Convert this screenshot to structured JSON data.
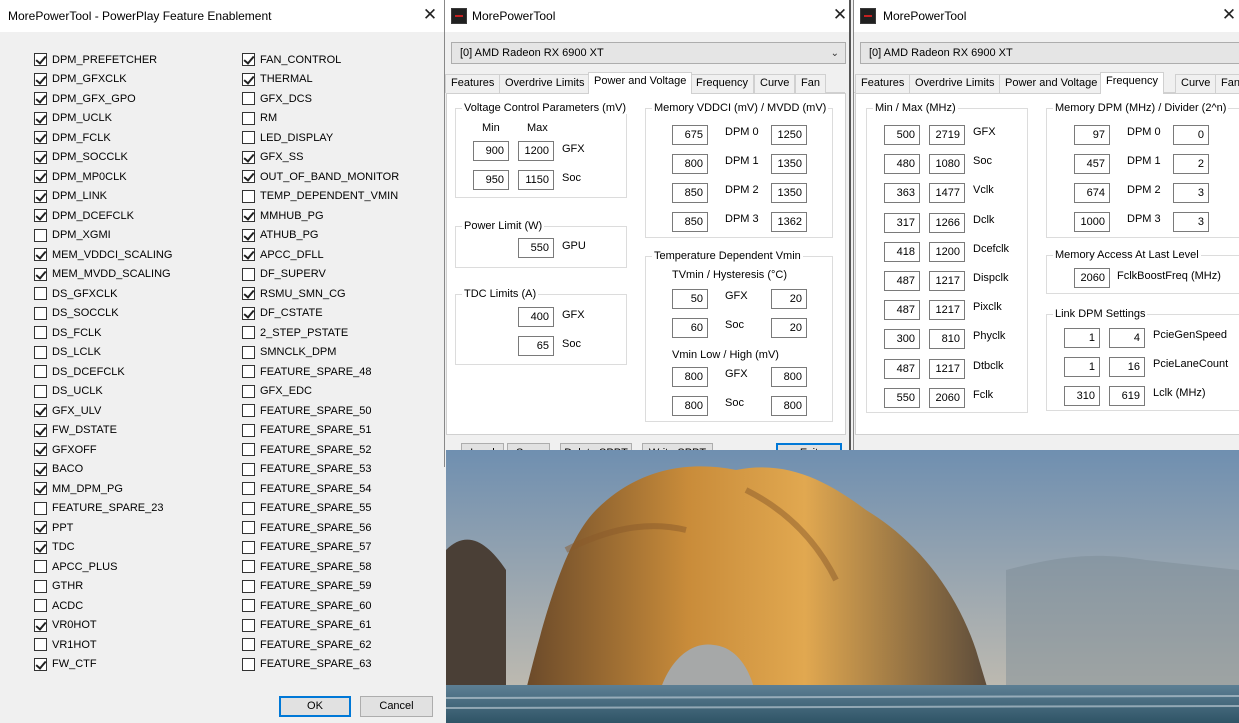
{
  "win1": {
    "title": "MorePowerTool - PowerPlay Feature Enablement",
    "close": "✕",
    "col1": [
      {
        "label": "DPM_PREFETCHER",
        "checked": true
      },
      {
        "label": "DPM_GFXCLK",
        "checked": true
      },
      {
        "label": "DPM_GFX_GPO",
        "checked": true
      },
      {
        "label": "DPM_UCLK",
        "checked": true
      },
      {
        "label": "DPM_FCLK",
        "checked": true
      },
      {
        "label": "DPM_SOCCLK",
        "checked": true
      },
      {
        "label": "DPM_MP0CLK",
        "checked": true
      },
      {
        "label": "DPM_LINK",
        "checked": true
      },
      {
        "label": "DPM_DCEFCLK",
        "checked": true
      },
      {
        "label": "DPM_XGMI",
        "checked": false
      },
      {
        "label": "MEM_VDDCI_SCALING",
        "checked": true
      },
      {
        "label": "MEM_MVDD_SCALING",
        "checked": true
      },
      {
        "label": "DS_GFXCLK",
        "checked": false
      },
      {
        "label": "DS_SOCCLK",
        "checked": false
      },
      {
        "label": "DS_FCLK",
        "checked": false
      },
      {
        "label": "DS_LCLK",
        "checked": false
      },
      {
        "label": "DS_DCEFCLK",
        "checked": false
      },
      {
        "label": "DS_UCLK",
        "checked": false
      },
      {
        "label": "GFX_ULV",
        "checked": true
      },
      {
        "label": "FW_DSTATE",
        "checked": true
      },
      {
        "label": "GFXOFF",
        "checked": true
      },
      {
        "label": "BACO",
        "checked": true
      },
      {
        "label": "MM_DPM_PG",
        "checked": true
      },
      {
        "label": "FEATURE_SPARE_23",
        "checked": false
      },
      {
        "label": "PPT",
        "checked": true
      },
      {
        "label": "TDC",
        "checked": true
      },
      {
        "label": "APCC_PLUS",
        "checked": false
      },
      {
        "label": "GTHR",
        "checked": false
      },
      {
        "label": "ACDC",
        "checked": false
      },
      {
        "label": "VR0HOT",
        "checked": true
      },
      {
        "label": "VR1HOT",
        "checked": false
      },
      {
        "label": "FW_CTF",
        "checked": true
      }
    ],
    "col2": [
      {
        "label": "FAN_CONTROL",
        "checked": true
      },
      {
        "label": "THERMAL",
        "checked": true
      },
      {
        "label": "GFX_DCS",
        "checked": false
      },
      {
        "label": "RM",
        "checked": false
      },
      {
        "label": "LED_DISPLAY",
        "checked": false
      },
      {
        "label": "GFX_SS",
        "checked": true
      },
      {
        "label": "OUT_OF_BAND_MONITOR",
        "checked": true
      },
      {
        "label": "TEMP_DEPENDENT_VMIN",
        "checked": false
      },
      {
        "label": "MMHUB_PG",
        "checked": true
      },
      {
        "label": "ATHUB_PG",
        "checked": true
      },
      {
        "label": "APCC_DFLL",
        "checked": true
      },
      {
        "label": "DF_SUPERV",
        "checked": false
      },
      {
        "label": "RSMU_SMN_CG",
        "checked": true
      },
      {
        "label": "DF_CSTATE",
        "checked": true
      },
      {
        "label": "2_STEP_PSTATE",
        "checked": false
      },
      {
        "label": "SMNCLK_DPM",
        "checked": false
      },
      {
        "label": "FEATURE_SPARE_48",
        "checked": false
      },
      {
        "label": "GFX_EDC",
        "checked": false
      },
      {
        "label": "FEATURE_SPARE_50",
        "checked": false
      },
      {
        "label": "FEATURE_SPARE_51",
        "checked": false
      },
      {
        "label": "FEATURE_SPARE_52",
        "checked": false
      },
      {
        "label": "FEATURE_SPARE_53",
        "checked": false
      },
      {
        "label": "FEATURE_SPARE_54",
        "checked": false
      },
      {
        "label": "FEATURE_SPARE_55",
        "checked": false
      },
      {
        "label": "FEATURE_SPARE_56",
        "checked": false
      },
      {
        "label": "FEATURE_SPARE_57",
        "checked": false
      },
      {
        "label": "FEATURE_SPARE_58",
        "checked": false
      },
      {
        "label": "FEATURE_SPARE_59",
        "checked": false
      },
      {
        "label": "FEATURE_SPARE_60",
        "checked": false
      },
      {
        "label": "FEATURE_SPARE_61",
        "checked": false
      },
      {
        "label": "FEATURE_SPARE_62",
        "checked": false
      },
      {
        "label": "FEATURE_SPARE_63",
        "checked": false
      }
    ],
    "ok": "OK",
    "cancel": "Cancel"
  },
  "win2": {
    "title": "MorePowerTool",
    "close": "✕",
    "gpu": "[0] AMD Radeon RX 6900 XT",
    "tabs": [
      "Features",
      "Overdrive Limits",
      "Power and Voltage",
      "Frequency",
      "Curve",
      "Fan"
    ],
    "voltage": {
      "title": "Voltage Control Parameters (mV)",
      "min": "Min",
      "max": "Max",
      "gfx_label": "GFX",
      "gfx_min": "900",
      "gfx_max": "1200",
      "soc_label": "Soc",
      "soc_min": "950",
      "soc_max": "1150"
    },
    "power": {
      "title": "Power Limit (W)",
      "gpu_label": "GPU",
      "gpu": "550"
    },
    "tdc": {
      "title": "TDC Limits (A)",
      "gfx_label": "GFX",
      "gfx": "400",
      "soc_label": "Soc",
      "soc": "65"
    },
    "memory": {
      "title": "Memory VDDCI (mV) / MVDD (mV)",
      "rows": [
        {
          "label": "DPM 0",
          "vddci": "675",
          "mvdd": "1250"
        },
        {
          "label": "DPM 1",
          "vddci": "800",
          "mvdd": "1350"
        },
        {
          "label": "DPM 2",
          "vddci": "850",
          "mvdd": "1350"
        },
        {
          "label": "DPM 3",
          "vddci": "850",
          "mvdd": "1362"
        }
      ]
    },
    "temp": {
      "title": "Temperature Dependent Vmin",
      "sub1": "TVmin / Hysteresis (°C)",
      "gfx_label": "GFX",
      "gfx_tvmin": "50",
      "gfx_hyst": "20",
      "soc_label": "Soc",
      "soc_tvmin": "60",
      "soc_hyst": "20",
      "sub2": "Vmin Low / High (mV)",
      "vgfx_label": "GFX",
      "vgfx_low": "800",
      "vgfx_high": "800",
      "vsoc_label": "Soc",
      "vsoc_low": "800",
      "vsoc_high": "800"
    },
    "buttons": {
      "load": "Load",
      "save": "Save",
      "delete": "Delete SPPT",
      "write": "Write SPPT",
      "exit": "Exit"
    }
  },
  "win3": {
    "title": "MorePowerTool",
    "close": "✕",
    "gpu": "[0] AMD Radeon RX 6900 XT",
    "tabs": [
      "Features",
      "Overdrive Limits",
      "Power and Voltage",
      "Frequency",
      "Curve",
      "Fan"
    ],
    "minmax": {
      "title": "Min / Max (MHz)",
      "rows": [
        {
          "label": "GFX",
          "min": "500",
          "max": "2719"
        },
        {
          "label": "Soc",
          "min": "480",
          "max": "1080"
        },
        {
          "label": "Vclk",
          "min": "363",
          "max": "1477"
        },
        {
          "label": "Dclk",
          "min": "317",
          "max": "1266"
        },
        {
          "label": "Dcefclk",
          "min": "418",
          "max": "1200"
        },
        {
          "label": "Dispclk",
          "min": "487",
          "max": "1217"
        },
        {
          "label": "Pixclk",
          "min": "487",
          "max": "1217"
        },
        {
          "label": "Phyclk",
          "min": "300",
          "max": "810"
        },
        {
          "label": "Dtbclk",
          "min": "487",
          "max": "1217"
        },
        {
          "label": "Fclk",
          "min": "550",
          "max": "2060"
        }
      ]
    },
    "memdpm": {
      "title": "Memory DPM (MHz) / Divider (2^n)",
      "rows": [
        {
          "label": "DPM 0",
          "mhz": "97",
          "div": "0"
        },
        {
          "label": "DPM 1",
          "mhz": "457",
          "div": "2"
        },
        {
          "label": "DPM 2",
          "mhz": "674",
          "div": "3"
        },
        {
          "label": "DPM 3",
          "mhz": "1000",
          "div": "3"
        }
      ]
    },
    "access": {
      "title": "Memory Access At Last Level",
      "value": "2060",
      "label": "FclkBoostFreq (MHz)"
    },
    "link": {
      "title": "Link DPM Settings",
      "rows": [
        {
          "label": "PcieGenSpeed",
          "a": "1",
          "b": "4"
        },
        {
          "label": "PcieLaneCount",
          "a": "1",
          "b": "16"
        },
        {
          "label": "Lclk (MHz)",
          "a": "310",
          "b": "619"
        }
      ]
    }
  }
}
